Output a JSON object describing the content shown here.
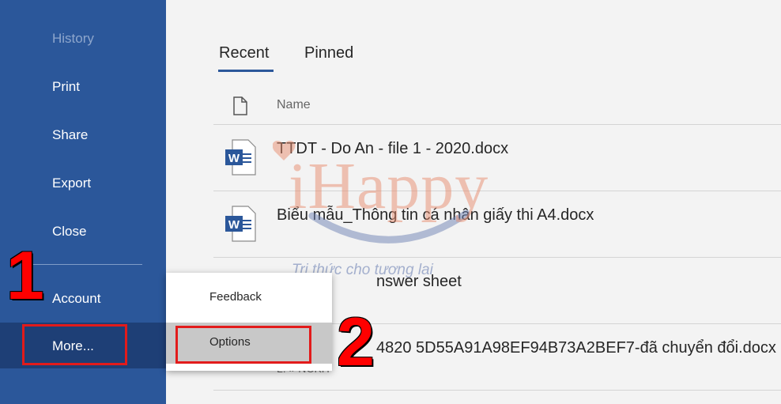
{
  "sidebar": {
    "items": [
      {
        "label": "History",
        "disabled": true
      },
      {
        "label": "Print"
      },
      {
        "label": "Share"
      },
      {
        "label": "Export"
      },
      {
        "label": "Close"
      },
      {
        "label": "Account"
      },
      {
        "label": "More..."
      }
    ]
  },
  "tabs": [
    {
      "label": "Recent",
      "active": true
    },
    {
      "label": "Pinned",
      "active": false
    }
  ],
  "list": {
    "header_name": "Name",
    "files": [
      {
        "name": "TTDT - Do An - file 1 - 2020.docx",
        "path": ""
      },
      {
        "name": "Biểu mẫu_Thông tin cá nhân giấy thi A4.docx",
        "path": ""
      },
      {
        "name": "nswer sheet",
        "path": ""
      },
      {
        "name": "4820 5D55A91A98EF94B73A2BEF7-đã chuyển đổi.docx",
        "path": "L: » NCKH"
      }
    ]
  },
  "flyout": {
    "items": [
      {
        "label": "Feedback"
      },
      {
        "label": "Options",
        "highlighted": true
      }
    ]
  },
  "annotations": {
    "step1": "1",
    "step2": "2"
  },
  "watermark": {
    "logo": "iHappy",
    "tagline": "Tri thức cho tương lai"
  },
  "colors": {
    "sidebar_bg": "#2b579a",
    "accent": "#2b579a",
    "annotation_red": "#e21b1b"
  }
}
